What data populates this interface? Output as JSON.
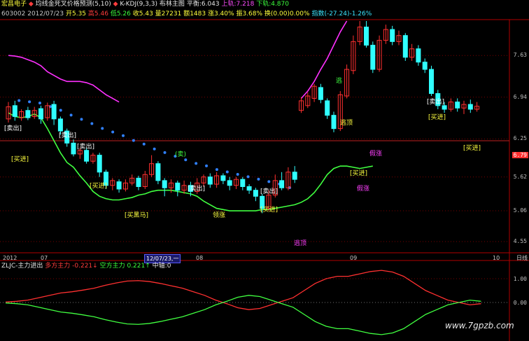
{
  "header": {
    "stock_name": "宏昌电子",
    "formula_name": "均线金死叉价格预测(5,10)",
    "kdj_label": "K-KDJ(9,3,3)",
    "boll_label": "布林主图",
    "avg_label": "平衡:6.043",
    "upper_label": "上轨:7.218",
    "lower_label": "下轨:4.870",
    "code": "603002",
    "date": "2012/07/23",
    "open": "开5.35",
    "high": "高5.46",
    "low": "低5.26",
    "close": "收5.43",
    "volume": "量27231",
    "amount": "额1483",
    "change": "涨3.40%",
    "amplitude": "振3.68%",
    "turnover": "换(0.00)0.00%",
    "index": "指数(-27.24)-1.26%"
  },
  "price_axis": {
    "ticks": [
      "7.63",
      "6.94",
      "6.25",
      "5.62",
      "5.06",
      "4.55"
    ],
    "current_value": "6.94",
    "current_price": "6.79"
  },
  "time_axis": {
    "labels": [
      "2012",
      "07",
      "08",
      "09",
      "10"
    ],
    "cursor_date": "12/07/23,一",
    "zoom_hint": "日线"
  },
  "indicator": {
    "name": "ZLJC-主力进出",
    "long_label": "多方主力",
    "long_value": "-0.221",
    "short_label": "空方主力",
    "short_value": "0.221",
    "zero_label": "中轴",
    "zero_value": "0",
    "ticks": [
      "1.00",
      "0.00"
    ]
  },
  "markers": {
    "sell": "卖出",
    "buy": "买进",
    "buy_horse": "买黑马",
    "sell2": "卖",
    "up": "逃",
    "escape": "逃顶",
    "fake_rise": "假涨",
    "sell_top": "逃顶",
    "lead": "领涨"
  },
  "watermark": "www.7gpzb.com",
  "colors": {
    "up": "#ff3030",
    "down": "#30ffff",
    "upper_band": "#ff30ff",
    "lower_band": "#40ff40",
    "dots_blue": "#3080ff",
    "dots_red": "#ff2020",
    "grid": "#7a0000"
  },
  "chart_data": {
    "type": "candlestick",
    "title": "",
    "ylim": [
      4.4,
      8.2
    ],
    "candles": [
      {
        "o": 6.58,
        "c": 6.78,
        "h": 6.86,
        "l": 6.52,
        "up": true
      },
      {
        "o": 6.8,
        "c": 6.62,
        "h": 6.88,
        "l": 6.55,
        "up": false
      },
      {
        "o": 6.6,
        "c": 6.7,
        "h": 6.74,
        "l": 6.55,
        "up": true
      },
      {
        "o": 6.72,
        "c": 6.6,
        "h": 6.78,
        "l": 6.56,
        "up": false
      },
      {
        "o": 6.62,
        "c": 6.72,
        "h": 6.78,
        "l": 6.58,
        "up": true
      },
      {
        "o": 6.75,
        "c": 6.58,
        "h": 6.8,
        "l": 6.5,
        "up": false
      },
      {
        "o": 6.6,
        "c": 6.8,
        "h": 6.85,
        "l": 6.55,
        "up": true
      },
      {
        "o": 6.82,
        "c": 6.58,
        "h": 6.88,
        "l": 6.48,
        "up": false
      },
      {
        "o": 6.58,
        "c": 6.38,
        "h": 6.62,
        "l": 6.32,
        "up": false
      },
      {
        "o": 6.38,
        "c": 6.18,
        "h": 6.42,
        "l": 6.12,
        "up": false
      },
      {
        "o": 6.18,
        "c": 6.0,
        "h": 6.24,
        "l": 5.96,
        "up": false
      },
      {
        "o": 6.0,
        "c": 6.06,
        "h": 6.1,
        "l": 5.92,
        "up": true
      },
      {
        "o": 6.06,
        "c": 5.88,
        "h": 6.1,
        "l": 5.84,
        "up": false
      },
      {
        "o": 5.88,
        "c": 5.98,
        "h": 6.02,
        "l": 5.84,
        "up": true
      },
      {
        "o": 5.98,
        "c": 5.7,
        "h": 6.02,
        "l": 5.62,
        "up": false
      },
      {
        "o": 5.7,
        "c": 5.48,
        "h": 5.74,
        "l": 5.42,
        "up": false
      },
      {
        "o": 5.48,
        "c": 5.56,
        "h": 5.6,
        "l": 5.4,
        "up": true
      },
      {
        "o": 5.54,
        "c": 5.42,
        "h": 5.58,
        "l": 5.36,
        "up": false
      },
      {
        "o": 5.42,
        "c": 5.52,
        "h": 5.58,
        "l": 5.38,
        "up": true
      },
      {
        "o": 5.52,
        "c": 5.6,
        "h": 5.66,
        "l": 5.48,
        "up": true
      },
      {
        "o": 5.6,
        "c": 5.46,
        "h": 5.64,
        "l": 5.4,
        "up": false
      },
      {
        "o": 5.46,
        "c": 5.66,
        "h": 5.72,
        "l": 5.42,
        "up": true
      },
      {
        "o": 5.66,
        "c": 5.84,
        "h": 5.98,
        "l": 5.62,
        "up": true
      },
      {
        "o": 5.84,
        "c": 5.56,
        "h": 5.88,
        "l": 5.5,
        "up": false
      },
      {
        "o": 5.56,
        "c": 5.44,
        "h": 5.6,
        "l": 5.3,
        "up": false
      },
      {
        "o": 5.44,
        "c": 5.52,
        "h": 5.58,
        "l": 5.36,
        "up": true
      },
      {
        "o": 5.52,
        "c": 5.4,
        "h": 5.56,
        "l": 5.3,
        "up": false
      },
      {
        "o": 5.4,
        "c": 5.48,
        "h": 5.56,
        "l": 5.34,
        "up": true
      },
      {
        "o": 5.48,
        "c": 5.38,
        "h": 5.54,
        "l": 5.3,
        "up": false
      },
      {
        "o": 5.38,
        "c": 5.52,
        "h": 5.6,
        "l": 5.34,
        "up": true
      },
      {
        "o": 5.52,
        "c": 5.62,
        "h": 5.66,
        "l": 5.46,
        "up": true
      },
      {
        "o": 5.62,
        "c": 5.5,
        "h": 5.68,
        "l": 5.44,
        "up": false
      },
      {
        "o": 5.5,
        "c": 5.64,
        "h": 5.7,
        "l": 5.44,
        "up": true
      },
      {
        "o": 5.64,
        "c": 5.56,
        "h": 5.68,
        "l": 5.5,
        "up": false
      },
      {
        "o": 5.56,
        "c": 5.48,
        "h": 5.62,
        "l": 5.4,
        "up": false
      },
      {
        "o": 5.48,
        "c": 5.58,
        "h": 5.62,
        "l": 5.42,
        "up": true
      },
      {
        "o": 5.58,
        "c": 5.46,
        "h": 5.62,
        "l": 5.4,
        "up": false
      },
      {
        "o": 5.46,
        "c": 5.4,
        "h": 5.5,
        "l": 5.34,
        "up": false
      },
      {
        "o": 5.4,
        "c": 5.3,
        "h": 5.44,
        "l": 5.22,
        "up": false
      },
      {
        "o": 5.3,
        "c": 5.1,
        "h": 5.34,
        "l": 5.02,
        "up": false
      },
      {
        "o": 5.1,
        "c": 5.32,
        "h": 5.4,
        "l": 5.06,
        "up": true
      },
      {
        "o": 5.32,
        "c": 5.56,
        "h": 5.66,
        "l": 5.28,
        "up": true
      },
      {
        "o": 5.56,
        "c": 5.44,
        "h": 5.7,
        "l": 5.4,
        "up": false
      },
      {
        "o": 5.44,
        "c": 5.7,
        "h": 5.78,
        "l": 5.4,
        "up": true
      },
      {
        "o": 5.7,
        "c": 5.58,
        "h": 5.8,
        "l": 5.52,
        "up": false
      },
      {
        "o": 6.72,
        "c": 6.88,
        "h": 6.94,
        "l": 6.68,
        "up": true
      },
      {
        "o": 6.8,
        "c": 6.96,
        "h": 7.02,
        "l": 6.76,
        "up": true
      },
      {
        "o": 6.92,
        "c": 7.12,
        "h": 7.16,
        "l": 6.86,
        "up": true
      },
      {
        "o": 7.1,
        "c": 6.9,
        "h": 7.16,
        "l": 6.84,
        "up": false
      },
      {
        "o": 6.88,
        "c": 6.64,
        "h": 6.92,
        "l": 6.58,
        "up": false
      },
      {
        "o": 6.64,
        "c": 6.42,
        "h": 6.7,
        "l": 6.36,
        "up": false
      },
      {
        "o": 6.42,
        "c": 6.98,
        "h": 7.04,
        "l": 6.38,
        "up": true
      },
      {
        "o": 6.96,
        "c": 7.4,
        "h": 7.48,
        "l": 6.92,
        "up": true
      },
      {
        "o": 7.38,
        "c": 7.86,
        "h": 7.96,
        "l": 7.32,
        "up": true
      },
      {
        "o": 7.86,
        "c": 8.1,
        "h": 8.2,
        "l": 7.8,
        "up": true
      },
      {
        "o": 8.1,
        "c": 7.8,
        "h": 8.2,
        "l": 7.76,
        "up": false
      },
      {
        "o": 7.8,
        "c": 7.4,
        "h": 7.86,
        "l": 7.34,
        "up": false
      },
      {
        "o": 7.4,
        "c": 7.88,
        "h": 7.96,
        "l": 7.36,
        "up": true
      },
      {
        "o": 7.88,
        "c": 8.06,
        "h": 8.14,
        "l": 7.82,
        "up": true
      },
      {
        "o": 8.06,
        "c": 7.86,
        "h": 8.12,
        "l": 7.8,
        "up": false
      },
      {
        "o": 7.86,
        "c": 7.96,
        "h": 8.04,
        "l": 7.8,
        "up": true
      },
      {
        "o": 7.96,
        "c": 7.6,
        "h": 8.0,
        "l": 7.54,
        "up": false
      },
      {
        "o": 7.6,
        "c": 7.74,
        "h": 7.82,
        "l": 7.54,
        "up": true
      },
      {
        "o": 7.74,
        "c": 7.52,
        "h": 7.8,
        "l": 7.46,
        "up": false
      },
      {
        "o": 7.52,
        "c": 7.4,
        "h": 7.58,
        "l": 7.34,
        "up": false
      },
      {
        "o": 7.4,
        "c": 7.0,
        "h": 7.46,
        "l": 6.96,
        "up": false
      },
      {
        "o": 7.0,
        "c": 6.8,
        "h": 7.06,
        "l": 6.74,
        "up": false
      },
      {
        "o": 6.8,
        "c": 6.74,
        "h": 6.86,
        "l": 6.68,
        "up": false
      },
      {
        "o": 6.74,
        "c": 6.86,
        "h": 6.92,
        "l": 6.7,
        "up": true
      },
      {
        "o": 6.86,
        "c": 6.76,
        "h": 6.92,
        "l": 6.7,
        "up": false
      },
      {
        "o": 6.76,
        "c": 6.82,
        "h": 6.88,
        "l": 6.66,
        "up": true
      },
      {
        "o": 6.82,
        "c": 6.74,
        "h": 6.9,
        "l": 6.68,
        "up": false
      },
      {
        "o": 6.74,
        "c": 6.79,
        "h": 6.86,
        "l": 6.7,
        "up": true
      }
    ],
    "upper_band": [
      7.63,
      7.62,
      7.6,
      7.56,
      7.52,
      7.46,
      7.36,
      7.3,
      7.24,
      7.2,
      7.2,
      7.2,
      7.18,
      7.14,
      7.06,
      6.98,
      6.92,
      6.86,
      null,
      null,
      null,
      null,
      null,
      null,
      null,
      null,
      null,
      null,
      null,
      null,
      null,
      null,
      null,
      null,
      null,
      null,
      null,
      null,
      null,
      null,
      null,
      null,
      null,
      null,
      null,
      6.92,
      7.04,
      7.2,
      7.4,
      7.58,
      7.8,
      8.02,
      8.2
    ],
    "lower_band": [
      6.68,
      6.62,
      6.6,
      6.62,
      6.66,
      6.6,
      6.42,
      6.22,
      6.02,
      5.86,
      5.78,
      5.64,
      5.52,
      5.38,
      5.3,
      5.26,
      5.24,
      5.24,
      5.26,
      5.28,
      5.32,
      5.34,
      5.38,
      5.4,
      5.4,
      5.4,
      5.38,
      5.36,
      5.34,
      5.3,
      5.22,
      5.16,
      5.1,
      5.08,
      5.06,
      5.06,
      5.06,
      5.06,
      5.06,
      5.08,
      5.08,
      5.1,
      5.12,
      5.14,
      5.16,
      5.2,
      5.26,
      5.36,
      5.5,
      5.66,
      5.76,
      5.8,
      5.8,
      5.78,
      5.76,
      5.78,
      5.8
    ],
    "ma_dots": [
      6.86,
      6.84,
      6.82,
      6.76,
      6.7,
      6.62,
      6.55,
      6.48,
      6.4,
      6.34,
      6.28,
      6.2,
      6.14,
      6.06,
      6.0,
      5.94,
      5.88,
      5.82,
      5.78,
      5.72,
      5.68,
      5.64,
      5.6,
      5.56,
      5.52,
      5.48,
      5.42
    ],
    "zlj_long": [
      0.02,
      0.05,
      0.1,
      0.2,
      0.3,
      0.4,
      0.45,
      0.52,
      0.6,
      0.72,
      0.82,
      0.9,
      0.92,
      0.88,
      0.8,
      0.7,
      0.6,
      0.45,
      0.3,
      0.1,
      -0.05,
      -0.22,
      -0.3,
      -0.25,
      -0.1,
      0.05,
      0.2,
      0.5,
      0.8,
      1.0,
      1.1,
      1.1,
      1.2,
      1.3,
      1.35,
      1.28,
      1.1,
      0.8,
      0.5,
      0.3,
      0.1,
      0.0,
      -0.1,
      -0.05
    ],
    "zlj_short": [
      -0.02,
      -0.05,
      -0.1,
      -0.2,
      -0.3,
      -0.4,
      -0.45,
      -0.52,
      -0.6,
      -0.72,
      -0.82,
      -0.9,
      -0.92,
      -0.88,
      -0.8,
      -0.7,
      -0.6,
      -0.45,
      -0.3,
      -0.1,
      0.05,
      0.22,
      0.3,
      0.25,
      0.1,
      -0.05,
      -0.2,
      -0.5,
      -0.8,
      -1.0,
      -1.1,
      -1.1,
      -1.2,
      -1.3,
      -1.35,
      -1.28,
      -1.1,
      -0.8,
      -0.5,
      -0.3,
      -0.1,
      0.0,
      0.1,
      0.05
    ]
  }
}
